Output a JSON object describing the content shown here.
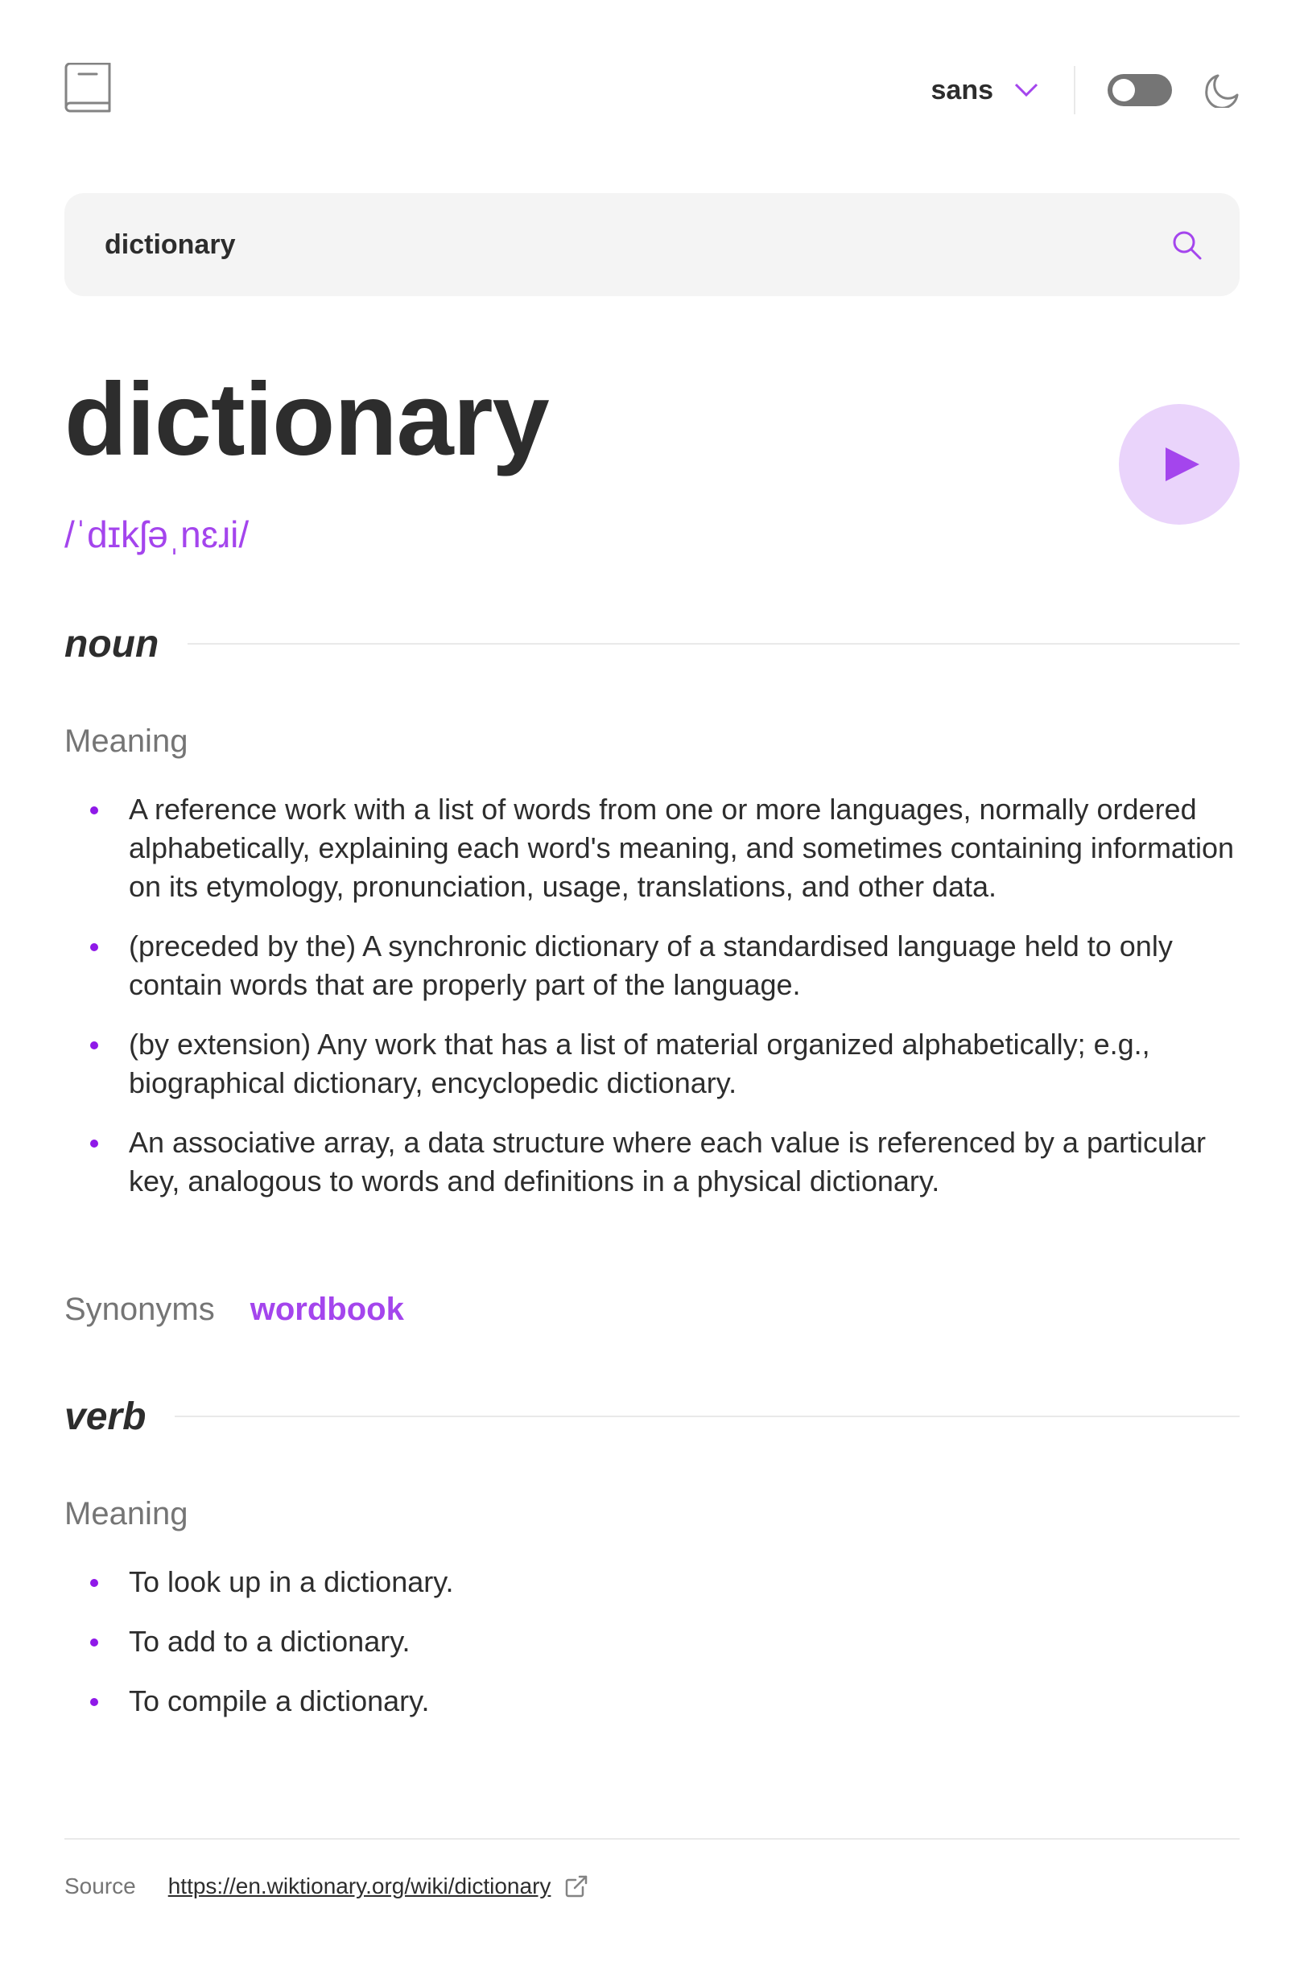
{
  "header": {
    "font_select": "sans",
    "theme_toggle_state": "off",
    "icons": [
      "book-icon",
      "chevron-down-icon",
      "moon-icon"
    ]
  },
  "search": {
    "value": "dictionary",
    "icon": "search-icon"
  },
  "entry": {
    "word": "dictionary",
    "phonetic": "/ˈdɪkʃəˌnɛɹi/",
    "play_icon": "play-icon"
  },
  "meanings": [
    {
      "part_of_speech": "noun",
      "meaning_label": "Meaning",
      "definitions": [
        "A reference work with a list of words from one or more languages, normally ordered alphabetically, explaining each word's meaning, and sometimes containing information on its etymology, pronunciation, usage, translations, and other data.",
        "(preceded by the) A synchronic dictionary of a standardised language held to only contain words that are properly part of the language.",
        "(by extension) Any work that has a list of material organized alphabetically; e.g., biographical dictionary, encyclopedic dictionary.",
        "An associative array, a data structure where each value is referenced by a particular key, analogous to words and definitions in a physical dictionary."
      ],
      "synonyms_label": "Synonyms",
      "synonyms": [
        "wordbook"
      ]
    },
    {
      "part_of_speech": "verb",
      "meaning_label": "Meaning",
      "definitions": [
        "To look up in a dictionary.",
        "To add to a dictionary.",
        "To compile a dictionary."
      ]
    }
  ],
  "footer": {
    "source_label": "Source",
    "source_url": "https://en.wiktionary.org/wiki/dictionary",
    "link_icon": "external-link-icon"
  },
  "colors": {
    "accent": "#a445ed",
    "text": "#2d2d2d",
    "muted": "#757575",
    "search_bg": "#f4f4f4",
    "play_bg": "#ead4fb"
  }
}
